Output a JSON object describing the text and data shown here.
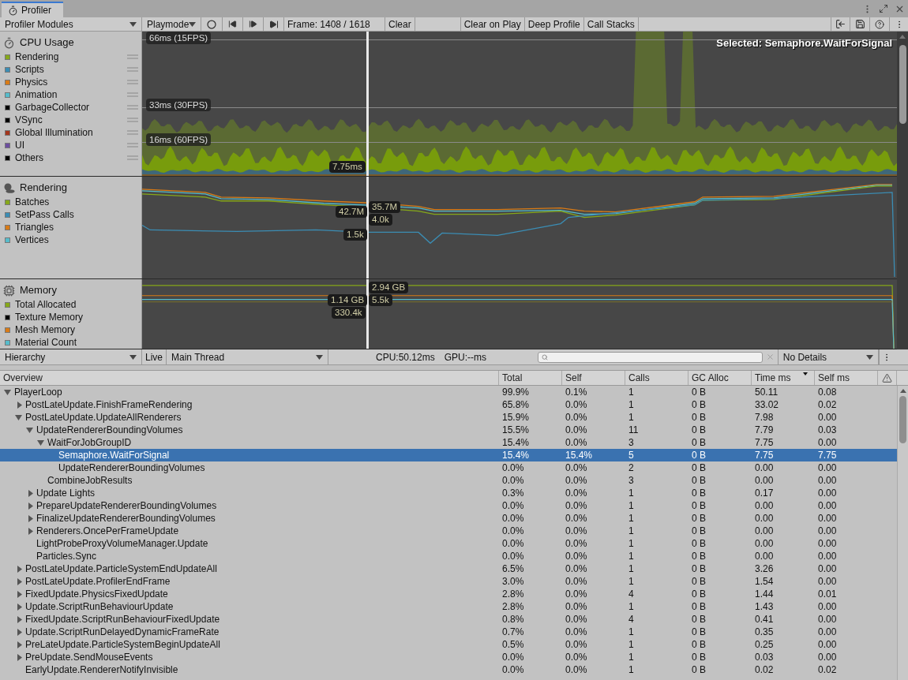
{
  "window": {
    "tab": "Profiler"
  },
  "toolbar": {
    "modules_dropdown": "Profiler Modules",
    "target_dropdown": "Playmode",
    "frame": "Frame: 1408 / 1618",
    "buttons": [
      "Clear",
      "Clear on Play",
      "Deep Profile",
      "Call Stacks"
    ]
  },
  "modules": [
    {
      "kind": "cpu",
      "title": "CPU Usage",
      "legend": [
        {
          "name": "Rendering",
          "color": "#86a819"
        },
        {
          "name": "Scripts",
          "color": "#3b8db4"
        },
        {
          "name": "Physics",
          "color": "#d97b16"
        },
        {
          "name": "Animation",
          "color": "#56bccb"
        },
        {
          "name": "GarbageCollector",
          "color": "#000000"
        },
        {
          "name": "VSync",
          "color": "#000000"
        },
        {
          "name": "Global Illumination",
          "color": "#a3361d"
        },
        {
          "name": "UI",
          "color": "#6d4ea0"
        },
        {
          "name": "Others",
          "color": "#000000"
        }
      ],
      "grid_labels": [
        "66ms (15FPS)",
        "33ms (30FPS)",
        "16ms (60FPS)"
      ],
      "value_labels": [
        "7.75ms"
      ],
      "selected_caption": "Selected: Semaphore.WaitForSignal"
    },
    {
      "kind": "rendering",
      "title": "Rendering",
      "legend": [
        {
          "name": "Batches",
          "color": "#86a819"
        },
        {
          "name": "SetPass Calls",
          "color": "#3b8db4"
        },
        {
          "name": "Triangles",
          "color": "#d97b16"
        },
        {
          "name": "Vertices",
          "color": "#56bccb"
        }
      ],
      "value_labels": [
        "42.7M",
        "35.7M",
        "4.0k",
        "1.5k"
      ]
    },
    {
      "kind": "memory",
      "title": "Memory",
      "legend": [
        {
          "name": "Total Allocated",
          "color": "#86a819"
        },
        {
          "name": "Texture Memory",
          "color": "#000000"
        },
        {
          "name": "Mesh Memory",
          "color": "#d97b16"
        },
        {
          "name": "Material Count",
          "color": "#56bccb"
        }
      ],
      "value_labels": [
        "2.94 GB",
        "1.14 GB",
        "5.5k",
        "330.4k"
      ]
    }
  ],
  "hierarchy": {
    "view_dropdown": "Hierarchy",
    "live": "Live",
    "thread_dropdown": "Main Thread",
    "cpu": "CPU:50.12ms",
    "gpu": "GPU:--ms",
    "details_dropdown": "No Details",
    "tree_column": "Overview",
    "columns": [
      {
        "label": "Total",
        "sorted": false
      },
      {
        "label": "Self",
        "sorted": false
      },
      {
        "label": "Calls",
        "sorted": false
      },
      {
        "label": "GC Alloc",
        "sorted": false
      },
      {
        "label": "Time ms",
        "sorted": true
      },
      {
        "label": "Self ms",
        "sorted": false
      }
    ],
    "rows": [
      {
        "name": "PlayerLoop",
        "cells": [
          "99.9%",
          "0.1%",
          "1",
          "0 B",
          "50.11",
          "0.08"
        ],
        "expanded": true,
        "selected": false,
        "children": [
          {
            "name": "PostLateUpdate.FinishFrameRendering",
            "cells": [
              "65.8%",
              "0.0%",
              "1",
              "0 B",
              "33.02",
              "0.02"
            ],
            "expanded": false,
            "selected": false
          },
          {
            "name": "PostLateUpdate.UpdateAllRenderers",
            "cells": [
              "15.9%",
              "0.0%",
              "1",
              "0 B",
              "7.98",
              "0.00"
            ],
            "expanded": true,
            "selected": false,
            "children": [
              {
                "name": "UpdateRendererBoundingVolumes",
                "cells": [
                  "15.5%",
                  "0.0%",
                  "11",
                  "0 B",
                  "7.79",
                  "0.03"
                ],
                "expanded": true,
                "selected": false,
                "children": [
                  {
                    "name": "WaitForJobGroupID",
                    "cells": [
                      "15.4%",
                      "0.0%",
                      "3",
                      "0 B",
                      "7.75",
                      "0.00"
                    ],
                    "expanded": true,
                    "selected": false,
                    "children": [
                      {
                        "name": "Semaphore.WaitForSignal",
                        "cells": [
                          "15.4%",
                          "15.4%",
                          "5",
                          "0 B",
                          "7.75",
                          "7.75"
                        ],
                        "selected": true
                      },
                      {
                        "name": "UpdateRendererBoundingVolumes",
                        "cells": [
                          "0.0%",
                          "0.0%",
                          "2",
                          "0 B",
                          "0.00",
                          "0.00"
                        ],
                        "selected": false
                      }
                    ]
                  },
                  {
                    "name": "CombineJobResults",
                    "cells": [
                      "0.0%",
                      "0.0%",
                      "3",
                      "0 B",
                      "0.00",
                      "0.00"
                    ],
                    "selected": false
                  }
                ]
              },
              {
                "name": "Update Lights",
                "cells": [
                  "0.3%",
                  "0.0%",
                  "1",
                  "0 B",
                  "0.17",
                  "0.00"
                ],
                "expanded": false,
                "selected": false
              },
              {
                "name": "PrepareUpdateRendererBoundingVolumes",
                "cells": [
                  "0.0%",
                  "0.0%",
                  "1",
                  "0 B",
                  "0.00",
                  "0.00"
                ],
                "expanded": false,
                "selected": false
              },
              {
                "name": "FinalizeUpdateRendererBoundingVolumes",
                "cells": [
                  "0.0%",
                  "0.0%",
                  "1",
                  "0 B",
                  "0.00",
                  "0.00"
                ],
                "expanded": false,
                "selected": false
              },
              {
                "name": "Renderers.OncePerFrameUpdate",
                "cells": [
                  "0.0%",
                  "0.0%",
                  "1",
                  "0 B",
                  "0.00",
                  "0.00"
                ],
                "expanded": false,
                "selected": false
              },
              {
                "name": "LightProbeProxyVolumeManager.Update",
                "cells": [
                  "0.0%",
                  "0.0%",
                  "1",
                  "0 B",
                  "0.00",
                  "0.00"
                ],
                "selected": false
              },
              {
                "name": "Particles.Sync",
                "cells": [
                  "0.0%",
                  "0.0%",
                  "1",
                  "0 B",
                  "0.00",
                  "0.00"
                ],
                "selected": false
              }
            ]
          },
          {
            "name": "PostLateUpdate.ParticleSystemEndUpdateAll",
            "cells": [
              "6.5%",
              "0.0%",
              "1",
              "0 B",
              "3.26",
              "0.00"
            ],
            "expanded": false,
            "selected": false
          },
          {
            "name": "PostLateUpdate.ProfilerEndFrame",
            "cells": [
              "3.0%",
              "0.0%",
              "1",
              "0 B",
              "1.54",
              "0.00"
            ],
            "expanded": false,
            "selected": false
          },
          {
            "name": "FixedUpdate.PhysicsFixedUpdate",
            "cells": [
              "2.8%",
              "0.0%",
              "4",
              "0 B",
              "1.44",
              "0.01"
            ],
            "expanded": false,
            "selected": false
          },
          {
            "name": "Update.ScriptRunBehaviourUpdate",
            "cells": [
              "2.8%",
              "0.0%",
              "1",
              "0 B",
              "1.43",
              "0.00"
            ],
            "expanded": false,
            "selected": false
          },
          {
            "name": "FixedUpdate.ScriptRunBehaviourFixedUpdate",
            "cells": [
              "0.8%",
              "0.0%",
              "4",
              "0 B",
              "0.41",
              "0.00"
            ],
            "expanded": false,
            "selected": false
          },
          {
            "name": "Update.ScriptRunDelayedDynamicFrameRate",
            "cells": [
              "0.7%",
              "0.0%",
              "1",
              "0 B",
              "0.35",
              "0.00"
            ],
            "expanded": false,
            "selected": false
          },
          {
            "name": "PreLateUpdate.ParticleSystemBeginUpdateAll",
            "cells": [
              "0.5%",
              "0.0%",
              "1",
              "0 B",
              "0.25",
              "0.00"
            ],
            "expanded": false,
            "selected": false
          },
          {
            "name": "PreUpdate.SendMouseEvents",
            "cells": [
              "0.0%",
              "0.0%",
              "1",
              "0 B",
              "0.03",
              "0.00"
            ],
            "expanded": false,
            "selected": false
          },
          {
            "name": "EarlyUpdate.RendererNotifyInvisible",
            "cells": [
              "0.0%",
              "0.0%",
              "1",
              "0 B",
              "0.02",
              "0.02"
            ],
            "selected": false
          }
        ]
      }
    ]
  }
}
